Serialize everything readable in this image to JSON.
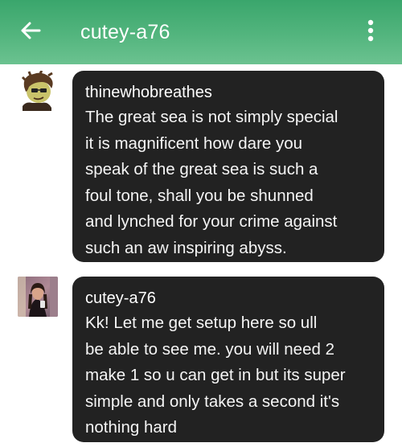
{
  "header": {
    "title": "cutey-a76",
    "back_icon": "arrow-left-icon",
    "menu_icon": "more-vertical-icon",
    "background": "#4cb07a"
  },
  "messages": [
    {
      "author": "thinewhobreathes",
      "avatar": "cartoon-avatar",
      "text": "The great sea is not simply special\nit is magnificent how dare you\nspeak of the great sea is such a\nfoul tone, shall you be shunned\nand lynched for your crime against\nsuch an aw inspiring abyss."
    },
    {
      "author": "cutey-a76",
      "avatar": "photo-avatar",
      "text": "Kk! Let me get setup here so ull\nbe able to see me. you will need 2\nmake 1 so u can get in but its super\nsimple and only takes a second it's\nnothing hard"
    }
  ],
  "colors": {
    "bubble": "#222222",
    "bubble_text": "#ffffff"
  }
}
